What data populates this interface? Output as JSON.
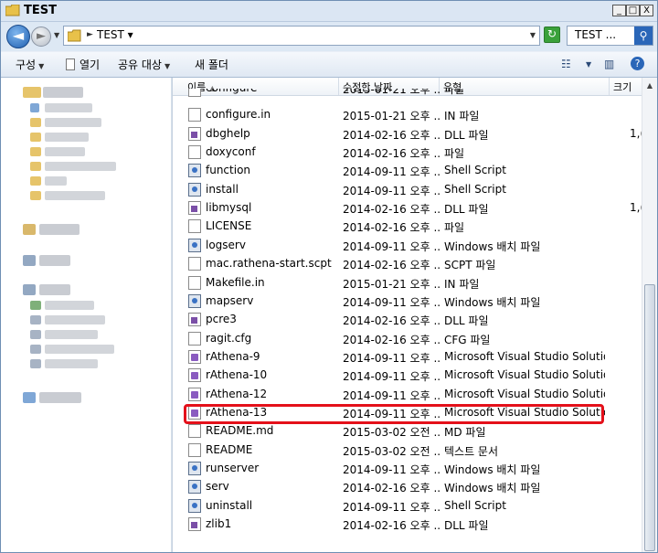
{
  "window": {
    "title": "TEST",
    "min_label": "_",
    "max_label": "□",
    "close_label": "X"
  },
  "address": {
    "crumb": "TEST",
    "search_placeholder": "TEST ...",
    "back_glyph": "◄",
    "forward_glyph": "►",
    "search_glyph": "⚲",
    "refresh_glyph": "↻"
  },
  "toolbar": {
    "organize": "구성",
    "open": "열기",
    "share": "공유 대상",
    "new_folder": "새 폴더",
    "view_glyph": "☷",
    "pane_glyph": "▥",
    "help_glyph": "?"
  },
  "columns": {
    "name": "이름",
    "date": "수정한 날짜",
    "type": "유형",
    "size": "크기"
  },
  "files": [
    {
      "name": "configure",
      "date": "2015-01-21 오후 ...",
      "type": "파일",
      "size": "",
      "icon": "generic-file-icon"
    },
    {
      "name": "configure.in",
      "date": "2015-01-21 오후 ...",
      "type": "IN 파일",
      "size": "",
      "icon": "generic-file-icon"
    },
    {
      "name": "dbghelp",
      "date": "2014-02-16 오후 ...",
      "type": "DLL 파일",
      "size": "1,(",
      "icon": "dll-file-icon"
    },
    {
      "name": "doxyconf",
      "date": "2014-02-16 오후 ...",
      "type": "파일",
      "size": "",
      "icon": "generic-file-icon"
    },
    {
      "name": "function",
      "date": "2014-09-11 오후 ...",
      "type": "Shell Script",
      "size": "",
      "icon": "shell-script-icon"
    },
    {
      "name": "install",
      "date": "2014-09-11 오후 ...",
      "type": "Shell Script",
      "size": "",
      "icon": "shell-script-icon"
    },
    {
      "name": "libmysql",
      "date": "2014-02-16 오후 ...",
      "type": "DLL 파일",
      "size": "1,(",
      "icon": "dll-file-icon"
    },
    {
      "name": "LICENSE",
      "date": "2014-02-16 오후 ...",
      "type": "파일",
      "size": "",
      "icon": "generic-file-icon"
    },
    {
      "name": "logserv",
      "date": "2014-09-11 오후 ...",
      "type": "Windows 배치 파일",
      "size": "",
      "icon": "batch-file-icon"
    },
    {
      "name": "mac.rathena-start.scpt",
      "date": "2014-02-16 오후 ...",
      "type": "SCPT 파일",
      "size": "",
      "icon": "generic-file-icon"
    },
    {
      "name": "Makefile.in",
      "date": "2015-01-21 오후 ...",
      "type": "IN 파일",
      "size": "",
      "icon": "generic-file-icon"
    },
    {
      "name": "mapserv",
      "date": "2014-09-11 오후 ...",
      "type": "Windows 배치 파일",
      "size": "",
      "icon": "batch-file-icon"
    },
    {
      "name": "pcre3",
      "date": "2014-02-16 오후 ...",
      "type": "DLL 파일",
      "size": "",
      "icon": "dll-file-icon"
    },
    {
      "name": "ragit.cfg",
      "date": "2014-02-16 오후 ...",
      "type": "CFG 파일",
      "size": "",
      "icon": "generic-file-icon"
    },
    {
      "name": "rAthena-9",
      "date": "2014-09-11 오후 ...",
      "type": "Microsoft Visual Studio Solution",
      "size": "",
      "icon": "vs-solution-icon"
    },
    {
      "name": "rAthena-10",
      "date": "2014-09-11 오후 ...",
      "type": "Microsoft Visual Studio Solution",
      "size": "",
      "icon": "vs-solution-icon"
    },
    {
      "name": "rAthena-12",
      "date": "2014-09-11 오후 ...",
      "type": "Microsoft Visual Studio Solution",
      "size": "",
      "icon": "vs-solution-icon"
    },
    {
      "name": "rAthena-13",
      "date": "2014-09-11 오후 ...",
      "type": "Microsoft Visual Studio Solution",
      "size": "",
      "icon": "vs-solution-icon"
    },
    {
      "name": "README.md",
      "date": "2015-03-02 오전 ...",
      "type": "MD 파일",
      "size": "",
      "icon": "generic-file-icon"
    },
    {
      "name": "README",
      "date": "2015-03-02 오전 ...",
      "type": "텍스트 문서",
      "size": "",
      "icon": "generic-file-icon"
    },
    {
      "name": "runserver",
      "date": "2014-09-11 오후 ...",
      "type": "Windows 배치 파일",
      "size": "",
      "icon": "batch-file-icon"
    },
    {
      "name": "serv",
      "date": "2014-02-16 오후 ...",
      "type": "Windows 배치 파일",
      "size": "",
      "icon": "batch-file-icon"
    },
    {
      "name": "uninstall",
      "date": "2014-09-11 오후 ...",
      "type": "Shell Script",
      "size": "",
      "icon": "shell-script-icon"
    },
    {
      "name": "zlib1",
      "date": "2014-02-16 오후 ...",
      "type": "DLL 파일",
      "size": "",
      "icon": "dll-file-icon"
    }
  ],
  "colors": {
    "highlight": "#e4101a",
    "window_border": "#6f8fb4"
  }
}
